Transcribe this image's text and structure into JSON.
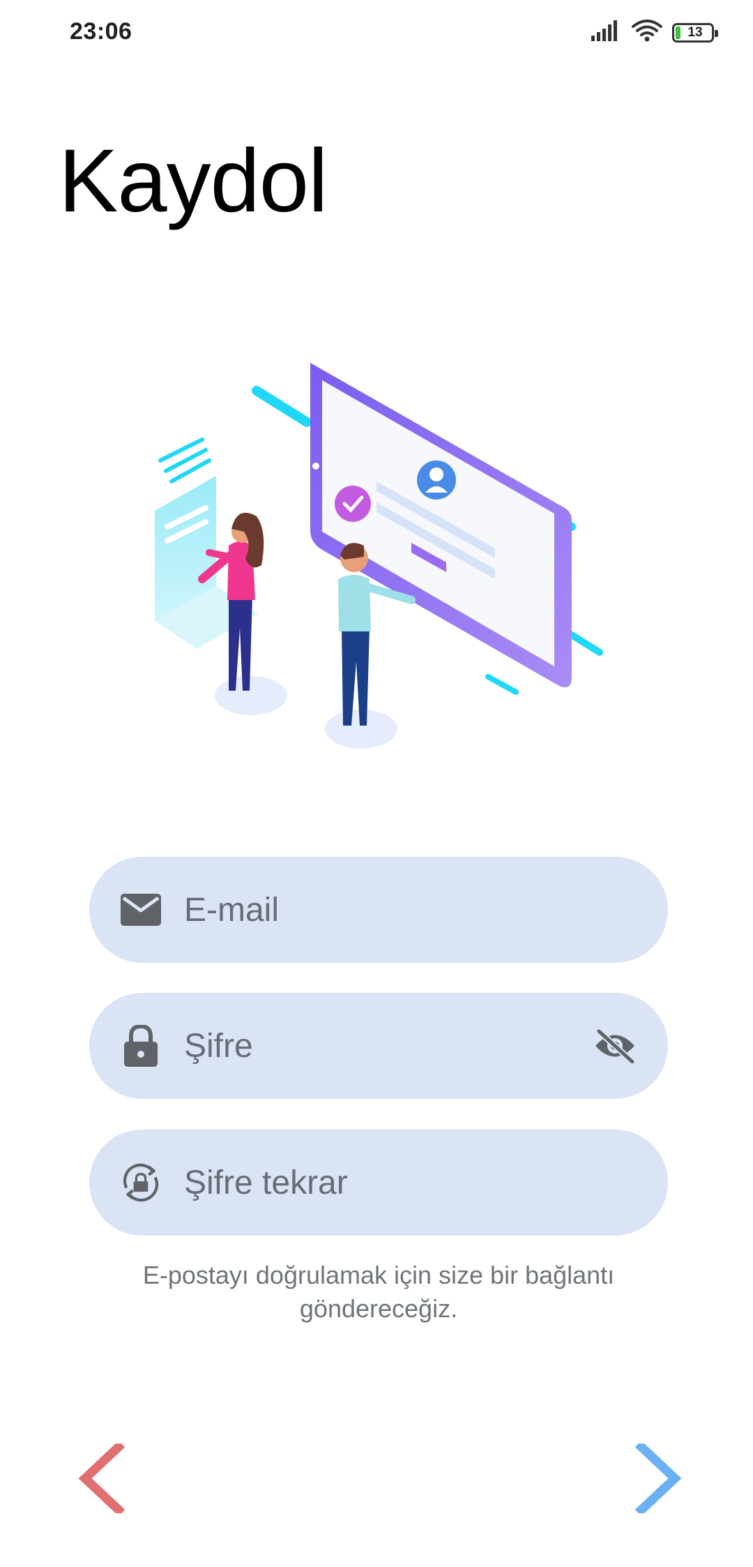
{
  "status_bar": {
    "time": "23:06",
    "battery_level": "13",
    "icons": [
      "signal-icon",
      "wifi-icon",
      "battery-icon"
    ]
  },
  "page": {
    "title": "Kaydol"
  },
  "form": {
    "email": {
      "placeholder": "E-mail",
      "value": "",
      "icon": "mail-icon"
    },
    "password": {
      "placeholder": "Şifre",
      "value": "",
      "icon": "lock-icon",
      "trailing_icon": "eye-off-icon"
    },
    "password_repeat": {
      "placeholder": "Şifre tekrar",
      "value": "",
      "icon": "lock-reset-icon"
    },
    "note": "E-postayı doğrulamak için size bir bağlantı göndereceğiz."
  },
  "navigation": {
    "back_icon": "chevron-left-icon",
    "next_icon": "chevron-right-icon"
  },
  "colors": {
    "field_background": "#dae4f4",
    "icon_gray": "#5f6368",
    "back_arrow": "#e07070",
    "next_arrow": "#6ab0f3",
    "placeholder": "#666d75",
    "note_text": "#6f747a"
  }
}
